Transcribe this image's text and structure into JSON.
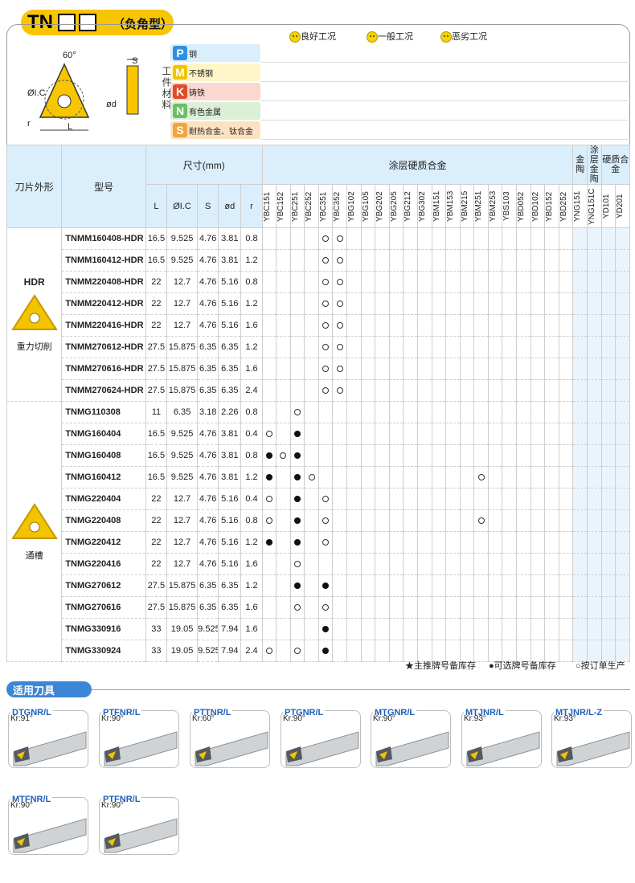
{
  "header": {
    "code": "TN",
    "subtitle": "（负角型）"
  },
  "legend": [
    {
      "icon": "good-face-icon",
      "label": "良好工况"
    },
    {
      "icon": "normal-face-icon",
      "label": "一般工况"
    },
    {
      "icon": "bad-face-icon",
      "label": "恶劣工况"
    }
  ],
  "diagram": {
    "angle": "60°",
    "s": "S",
    "ic": "ØI.C",
    "d": "ød",
    "r": "r",
    "l": "L"
  },
  "workpiece_label": "工件材料",
  "materials": [
    {
      "letter": "P",
      "name": "钢",
      "color": "#2f8fe0",
      "bg": "#dbeefc"
    },
    {
      "letter": "M",
      "name": "不锈钢",
      "color": "#f2c400",
      "bg": "#fff5c6"
    },
    {
      "letter": "K",
      "name": "铸铁",
      "color": "#e24a2a",
      "bg": "#fbd8cf"
    },
    {
      "letter": "N",
      "name": "有色金属",
      "color": "#6cbf62",
      "bg": "#dcefd7"
    },
    {
      "letter": "S",
      "name": "耐热合金、钛合金",
      "color": "#f0a63c",
      "bg": "#fde2c2"
    }
  ],
  "table": {
    "shape_header": "刀片外形",
    "model_header": "型号",
    "dim_header": "尺寸(mm)",
    "dim_cols": [
      "L",
      "ØI.C",
      "S",
      "ød",
      "r"
    ],
    "group_coated": "涂层硬质合金",
    "group_cermet": "金陶",
    "group_coated_cermet": "涂层金陶",
    "group_carbide": "硬质合金",
    "grades": [
      "YBC151",
      "YBC152",
      "YBC251",
      "YBC252",
      "YBC351",
      "YBC352",
      "YBG102",
      "YBG105",
      "YBG202",
      "YBG205",
      "YBG212",
      "YBG302",
      "YBM151",
      "YBM153",
      "YBM215",
      "YBM251",
      "YBM253",
      "YBS103",
      "YBD052",
      "YBD102",
      "YBD152",
      "YBD252",
      "YNG151",
      "YNG151C",
      "YD101",
      "YD201"
    ],
    "groups": [
      {
        "label": "HDR",
        "caption": "重力切削",
        "rows": [
          {
            "model": "TNMM160408-HDR",
            "L": "16.5",
            "IC": "9.525",
            "S": "4.76",
            "d": "3.81",
            "r": "0.8",
            "marks": {
              "4": "o",
              "5": "o"
            }
          },
          {
            "model": "TNMM160412-HDR",
            "L": "16.5",
            "IC": "9.525",
            "S": "4.76",
            "d": "3.81",
            "r": "1.2",
            "marks": {
              "4": "o",
              "5": "o"
            }
          },
          {
            "model": "TNMM220408-HDR",
            "L": "22",
            "IC": "12.7",
            "S": "4.76",
            "d": "5.16",
            "r": "0.8",
            "marks": {
              "4": "o",
              "5": "o"
            }
          },
          {
            "model": "TNMM220412-HDR",
            "L": "22",
            "IC": "12.7",
            "S": "4.76",
            "d": "5.16",
            "r": "1.2",
            "marks": {
              "4": "o",
              "5": "o"
            }
          },
          {
            "model": "TNMM220416-HDR",
            "L": "22",
            "IC": "12.7",
            "S": "4.76",
            "d": "5.16",
            "r": "1.6",
            "marks": {
              "4": "o",
              "5": "o"
            }
          },
          {
            "model": "TNMM270612-HDR",
            "L": "27.5",
            "IC": "15.875",
            "S": "6.35",
            "d": "6.35",
            "r": "1.2",
            "marks": {
              "4": "o",
              "5": "o"
            }
          },
          {
            "model": "TNMM270616-HDR",
            "L": "27.5",
            "IC": "15.875",
            "S": "6.35",
            "d": "6.35",
            "r": "1.6",
            "marks": {
              "4": "o",
              "5": "o"
            }
          },
          {
            "model": "TNMM270624-HDR",
            "L": "27.5",
            "IC": "15.875",
            "S": "6.35",
            "d": "6.35",
            "r": "2.4",
            "marks": {
              "4": "o",
              "5": "o"
            }
          }
        ]
      },
      {
        "label": "",
        "caption": "通槽",
        "rows": [
          {
            "model": "TNMG110308",
            "L": "11",
            "IC": "6.35",
            "S": "3.18",
            "d": "2.26",
            "r": "0.8",
            "marks": {
              "2": "o"
            }
          },
          {
            "model": "TNMG160404",
            "L": "16.5",
            "IC": "9.525",
            "S": "4.76",
            "d": "3.81",
            "r": "0.4",
            "marks": {
              "0": "o",
              "2": "f"
            }
          },
          {
            "model": "TNMG160408",
            "L": "16.5",
            "IC": "9.525",
            "S": "4.76",
            "d": "3.81",
            "r": "0.8",
            "marks": {
              "0": "f",
              "1": "o",
              "2": "f"
            }
          },
          {
            "model": "TNMG160412",
            "L": "16.5",
            "IC": "9.525",
            "S": "4.76",
            "d": "3.81",
            "r": "1.2",
            "marks": {
              "0": "f",
              "2": "f",
              "3": "o",
              "15": "o"
            }
          },
          {
            "model": "TNMG220404",
            "L": "22",
            "IC": "12.7",
            "S": "4.76",
            "d": "5.16",
            "r": "0.4",
            "marks": {
              "0": "o",
              "2": "f",
              "4": "o"
            }
          },
          {
            "model": "TNMG220408",
            "L": "22",
            "IC": "12.7",
            "S": "4.76",
            "d": "5.16",
            "r": "0.8",
            "marks": {
              "0": "o",
              "2": "f",
              "4": "o",
              "15": "o"
            }
          },
          {
            "model": "TNMG220412",
            "L": "22",
            "IC": "12.7",
            "S": "4.76",
            "d": "5.16",
            "r": "1.2",
            "marks": {
              "0": "f",
              "2": "f",
              "4": "o"
            }
          },
          {
            "model": "TNMG220416",
            "L": "22",
            "IC": "12.7",
            "S": "4.76",
            "d": "5.16",
            "r": "1.6",
            "marks": {
              "2": "o"
            }
          },
          {
            "model": "TNMG270612",
            "L": "27.5",
            "IC": "15.875",
            "S": "6.35",
            "d": "6.35",
            "r": "1.2",
            "marks": {
              "2": "f",
              "4": "f"
            }
          },
          {
            "model": "TNMG270616",
            "L": "27.5",
            "IC": "15.875",
            "S": "6.35",
            "d": "6.35",
            "r": "1.6",
            "marks": {
              "2": "o",
              "4": "o"
            }
          },
          {
            "model": "TNMG330916",
            "L": "33",
            "IC": "19.05",
            "S": "9.525",
            "d": "7.94",
            "r": "1.6",
            "marks": {
              "4": "f"
            }
          },
          {
            "model": "TNMG330924",
            "L": "33",
            "IC": "19.05",
            "S": "9.525",
            "d": "7.94",
            "r": "2.4",
            "marks": {
              "0": "o",
              "2": "o",
              "4": "f"
            }
          }
        ]
      }
    ]
  },
  "notes": {
    "star": "★主推牌号备库存",
    "filled": "●可选牌号备库存",
    "open": "○按订单生产"
  },
  "tools_title": "适用刀具",
  "tools": [
    {
      "name": "DTGNR/L",
      "kr": "Kr:91°"
    },
    {
      "name": "PTFNR/L",
      "kr": "Kr:90°"
    },
    {
      "name": "PTTNR/L",
      "kr": "Kr:60°"
    },
    {
      "name": "PTGNR/L",
      "kr": "Kr:90°"
    },
    {
      "name": "MTGNR/L",
      "kr": "Kr:90°"
    },
    {
      "name": "MTJNR/L",
      "kr": "Kr:93°"
    },
    {
      "name": "MTJNR/L-Z",
      "kr": "Kr:93°"
    },
    {
      "name": "MTFNR/L",
      "kr": "Kr:90°"
    },
    {
      "name": "PTFNR/L",
      "kr": "Kr:90°"
    }
  ]
}
